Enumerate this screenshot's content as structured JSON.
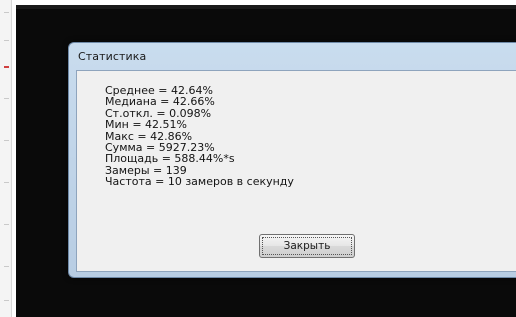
{
  "dialog": {
    "title": "Статистика",
    "stats": [
      "Среднее = 42.64%",
      "Медиана = 42.66%",
      "Ст.откл. = 0.098%",
      "Мин = 42.51%",
      "Макс = 42.86%",
      "Сумма = 5927.23%",
      "Площадь = 588.44%*s",
      "Замеры = 139",
      "Частота = 10 замеров в секунду"
    ],
    "close_label": "Закрыть"
  }
}
